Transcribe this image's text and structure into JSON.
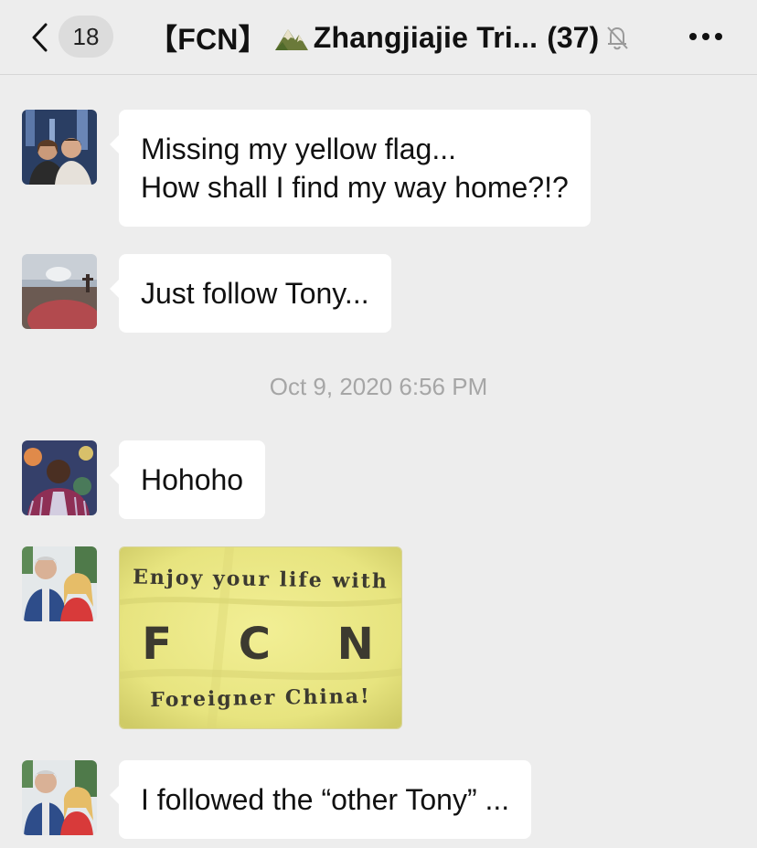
{
  "header": {
    "unread_count": "18",
    "title": "【FCN】",
    "title_rest": "Zhangjiajie Tri...",
    "member_count": "(37)",
    "icons": [
      "back-chevron-icon",
      "mountain-emoji-icon",
      "muted-bell-icon",
      "more-dots-icon"
    ]
  },
  "messages": [
    {
      "type": "text",
      "lines": [
        "Missing my yellow flag...",
        "How shall I find my way home?!?"
      ]
    },
    {
      "type": "text",
      "lines": [
        "Just follow Tony..."
      ]
    },
    {
      "type": "timestamp",
      "text": "Oct 9, 2020 6:56 PM"
    },
    {
      "type": "text",
      "lines": [
        "Hohoho"
      ]
    },
    {
      "type": "image",
      "lines": [
        "Enjoy your life with",
        "F C N",
        "Foreigner China!"
      ]
    },
    {
      "type": "text",
      "lines": [
        "I followed the “other Tony” ..."
      ]
    }
  ],
  "colors": {
    "background": "#ededed",
    "bubble": "#ffffff",
    "timestamp": "#a6a6a6",
    "flag": "#ece98a"
  }
}
